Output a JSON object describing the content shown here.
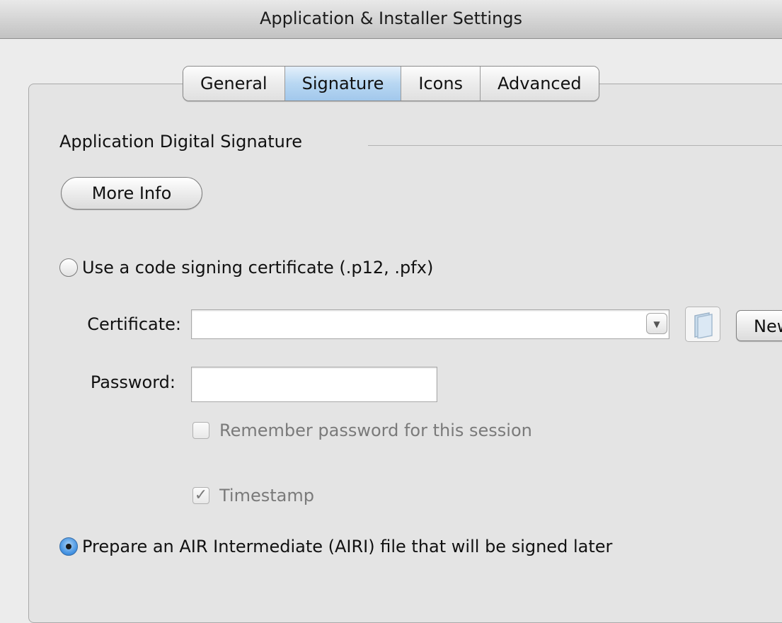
{
  "window": {
    "title": "Application & Installer Settings"
  },
  "tabs": [
    {
      "label": "General",
      "active": false
    },
    {
      "label": "Signature",
      "active": true
    },
    {
      "label": "Icons",
      "active": false
    },
    {
      "label": "Advanced",
      "active": false
    }
  ],
  "section": {
    "title": "Application Digital Signature"
  },
  "buttons": {
    "more_info": "More Info",
    "new": "New"
  },
  "options": {
    "use_certificate": {
      "label": "Use a code signing certificate (.p12, .pfx)",
      "selected": false
    },
    "prepare_airi": {
      "label": "Prepare an AIR Intermediate (AIRI) file that will be signed later",
      "selected": true
    }
  },
  "certificate": {
    "label": "Certificate:",
    "value": ""
  },
  "password": {
    "label": "Password:",
    "value": ""
  },
  "remember_password": {
    "label": "Remember password for this session",
    "checked": false,
    "enabled": false
  },
  "timestamp": {
    "label": "Timestamp",
    "checked": true,
    "enabled": false
  },
  "icons": {
    "dropdown": "chevron-down-icon",
    "folder": "folder-icon",
    "radio_on": "radio-selected-icon",
    "radio_off": "radio-unselected-icon",
    "checkmark": "checkmark-icon"
  },
  "colors": {
    "tab_active": "#b8d7f2",
    "radio_selected": "#3d8ee0",
    "disabled_text": "#7a7a7a"
  }
}
